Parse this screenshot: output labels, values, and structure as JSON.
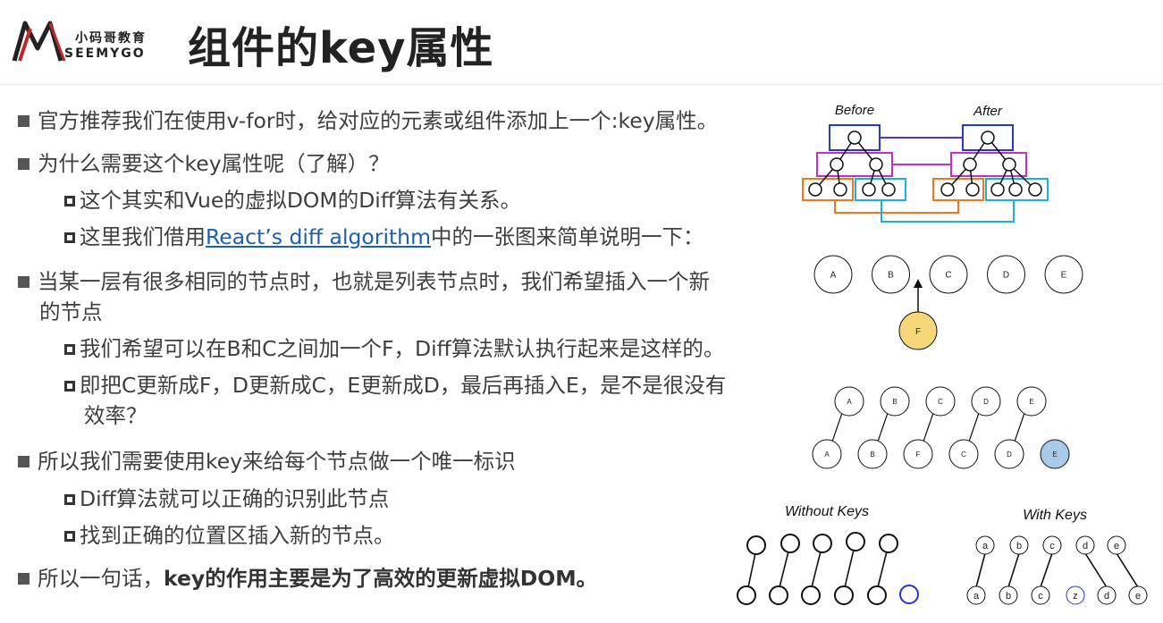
{
  "logo": {
    "brand_cn": "小码哥教育",
    "brand_en": "SEEMYGO"
  },
  "title": "组件的key属性",
  "items": {
    "b1": "官方推荐我们在使用v-for时，给对应的元素或组件添加上一个:key属性。",
    "b2": "为什么需要这个key属性呢（了解）？",
    "b2_1": "这个其实和Vue的虚拟DOM的Diff算法有关系。",
    "b2_2_pre": "这里我们借用",
    "b2_2_link": "React’s diff algorithm",
    "b2_2_post": "中的一张图来简单说明一下：",
    "b3_l1": "当某一层有很多相同的节点时，也就是列表节点时，我们希望插入一个新",
    "b3_l2": "的节点",
    "b3_1": "我们希望可以在B和C之间加一个F，Diff算法默认执行起来是这样的。",
    "b3_2_l1": "即把C更新成F，D更新成C，E更新成D，最后再插入E，是不是很没有",
    "b3_2_l2": "效率？",
    "b4": "所以我们需要使用key来给每个节点做一个唯一标识",
    "b4_1": "Diff算法就可以正确的识别此节点",
    "b4_2": "找到正确的位置区插入新的节点。",
    "b5_pre": "所以一句话，",
    "b5_bold": "key的作用主要是为了高效的更新虚拟DOM。"
  },
  "figures": {
    "tree": {
      "before_label": "Before",
      "after_label": "After"
    },
    "insert": {
      "nodes": [
        "A",
        "B",
        "C",
        "D",
        "E"
      ],
      "new_node": "F"
    },
    "diff": {
      "top": [
        "A",
        "B",
        "C",
        "D",
        "E"
      ],
      "bottom": [
        "A",
        "B",
        "F",
        "C",
        "D",
        "E"
      ]
    },
    "keys": {
      "without_label": "Without Keys",
      "with_label": "With Keys",
      "with_top": [
        "a",
        "b",
        "c",
        "d",
        "e"
      ],
      "with_bottom": [
        "a",
        "b",
        "c",
        "z",
        "d",
        "e"
      ]
    }
  },
  "colors": {
    "new_node_fill": "#f6d77a",
    "highlight_fill": "#a9cbe9",
    "link": "#1a5fb4"
  }
}
